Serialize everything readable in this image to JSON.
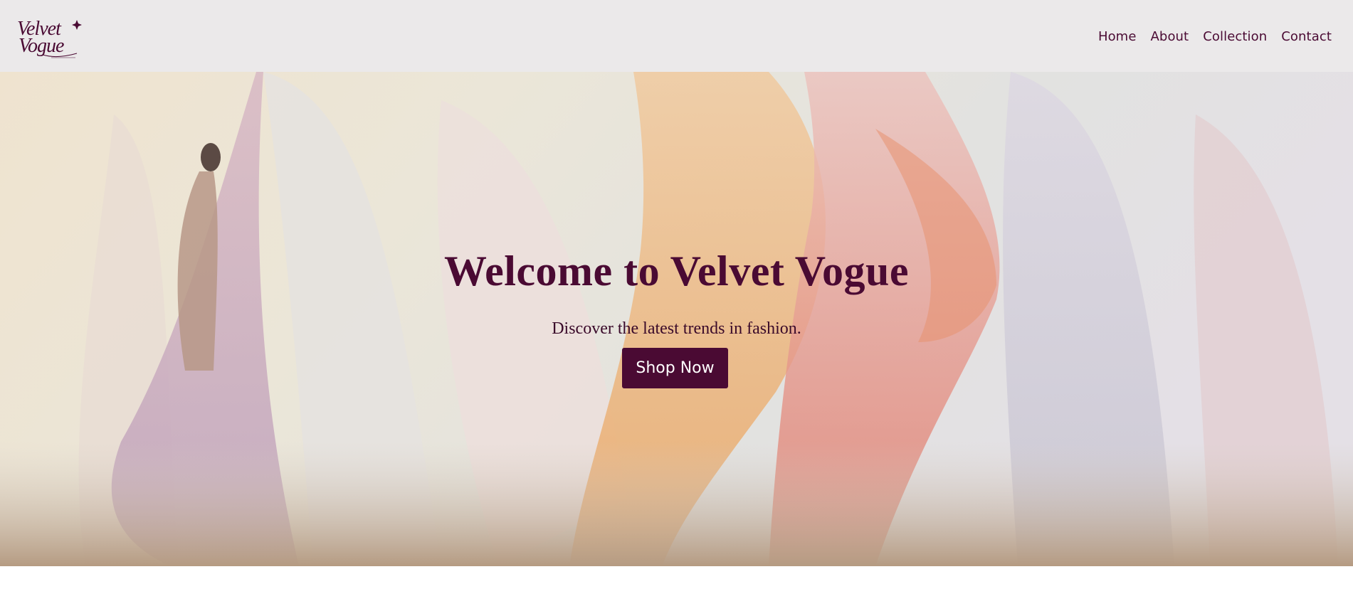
{
  "brand": {
    "logo_icon": "velvet-vogue-logo",
    "colors": {
      "primary": "#4a0a33",
      "header_bg": "#ebe9ea",
      "button_text": "#ffffff"
    }
  },
  "nav": {
    "items": [
      {
        "label": "Home"
      },
      {
        "label": "About"
      },
      {
        "label": "Collection"
      },
      {
        "label": "Contact"
      }
    ]
  },
  "hero": {
    "title": "Welcome to Velvet Vogue",
    "subtitle": "Discover the latest trends in fashion.",
    "cta_label": "Shop Now",
    "background_image": "flowing-pastel-fabric-banners"
  }
}
